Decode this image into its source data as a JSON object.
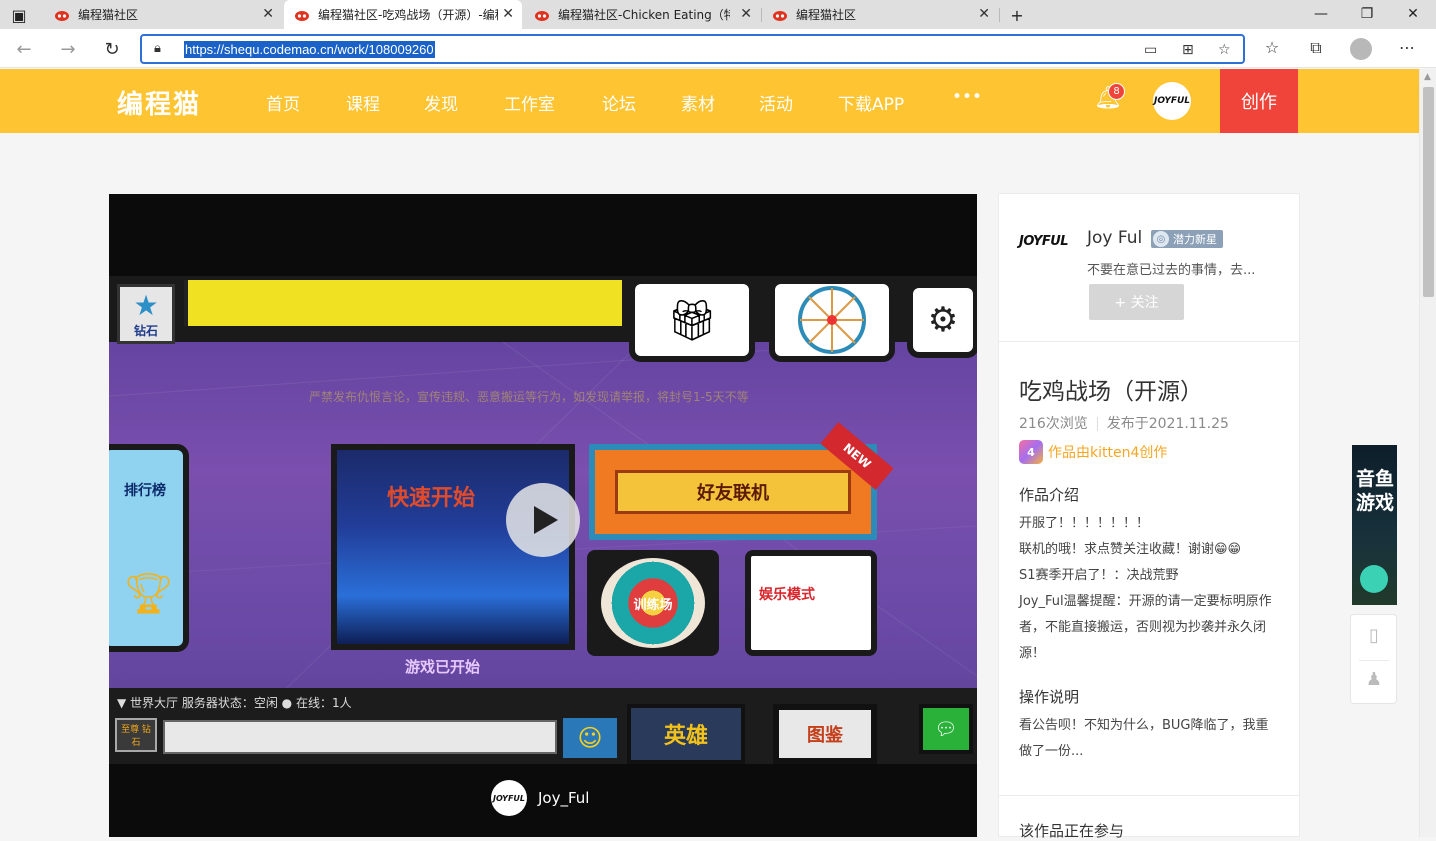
{
  "browser": {
    "tabs": [
      {
        "title": "编程猫社区",
        "active": false
      },
      {
        "title": "编程猫社区-吃鸡战场（开源）-编程猫社区",
        "active": true
      },
      {
        "title": "编程猫社区-Chicken Eating（特殊版本）",
        "active": false
      },
      {
        "title": "编程猫社区",
        "active": false
      }
    ],
    "url": "https://shequ.codemao.cn/work/108009260",
    "new_tab": "+"
  },
  "site": {
    "logo": "编程猫",
    "nav": [
      "首页",
      "课程",
      "发现",
      "工作室",
      "论坛",
      "素材",
      "活动",
      "下载APP",
      "•••"
    ],
    "notification_count": "8",
    "user_avatar_text": "JOYFUL",
    "create_label": "创作",
    "accent": "#ffc431",
    "create_color": "#f0443a"
  },
  "player": {
    "game": {
      "diamond_label": "钻石",
      "notice": "严禁发布仇恨言论，宣传违规、恶意搬运等行为，如发现请举报，将封号1-5天不等",
      "rank_label": "排行榜",
      "fast_start": "快速开始",
      "game_started": "游戏已开始",
      "friends_online": "好友联机",
      "new_tag": "NEW",
      "training": "训练场",
      "fun_mode": "娱乐模式",
      "world_lobby": "▼  世界大厅      服务器状态：空闲 ●                          在线：1人",
      "vip": "至尊\n钻石",
      "hero": "英雄",
      "atlas": "图鉴"
    },
    "author_avatar_text": "JOYFUL",
    "author_name": "Joy_Ful"
  },
  "sidebar": {
    "author_name": "Joy  Ful",
    "author_badge": "潜力新星",
    "author_motto": "不要在意已过去的事情，去...",
    "avatar_text": "JOYFUL",
    "follow_label": "+ 关注",
    "work_title": "吃鸡战场（开源）",
    "views": "216次浏览",
    "published": "发布于2021.11.25",
    "kitten_label": "作品由kitten4创作",
    "intro_heading": "作品介绍",
    "intro_lines": [
      "开服了！！！！！！！",
      "联机的哦！求点赞关注收藏！谢谢😁😁",
      "S1赛季开启了！：决战荒野",
      "Joy_Ful温馨提醒：开源的请一定要标明原作者，不能直接搬运，否则视为抄袭并永久闭源！"
    ],
    "ops_heading": "操作说明",
    "ops_text": "看公告呗！不知为什么，BUG降临了，我重做了一份...",
    "participate_heading": "该作品正在参与"
  },
  "floating": {
    "ad_text": "音鱼游戏"
  }
}
